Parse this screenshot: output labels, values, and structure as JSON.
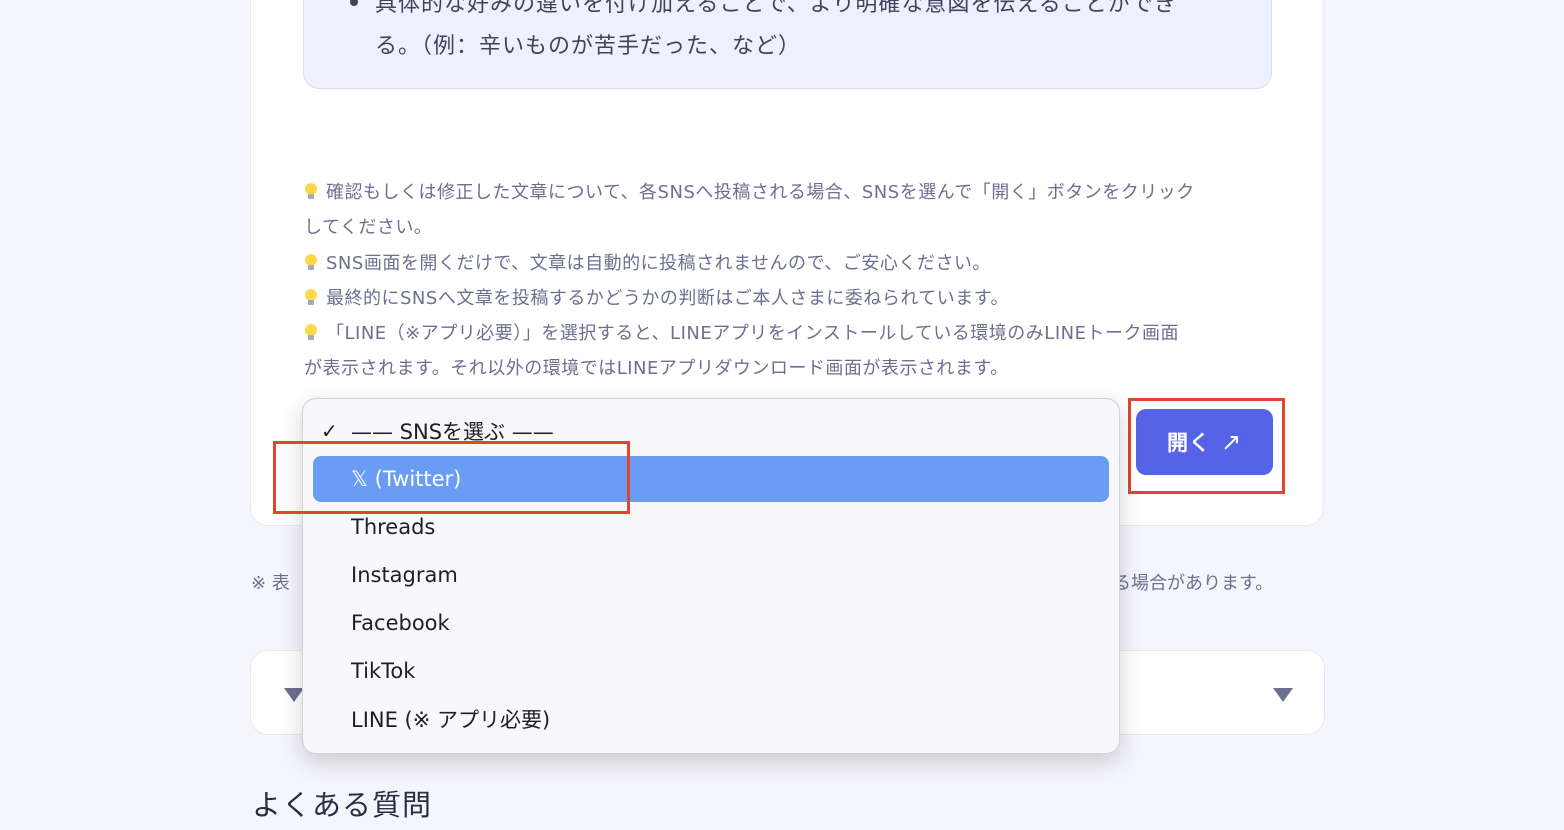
{
  "tip_box": {
    "line1": "具体的な好みの違いを付け加えることで、より明確な意図を伝えることができ",
    "line2": "る。（例：辛いものが苦手だった、など）"
  },
  "notes": {
    "n1a": "確認もしくは修正した文章について、各SNSへ投稿される場合、SNSを選んで「開く」ボタンをクリック",
    "n1b": "してください。",
    "n2": "SNS画面を開くだけで、文章は自動的に投稿されませんので、ご安心ください。",
    "n3": "最終的にSNSへ文章を投稿するかどうかの判断はご本人さまに委ねられています。",
    "n4a": "「LINE（※アプリ必要）」を選択すると、LINEアプリをインストールしている環境のみLINEトーク画面",
    "n4b": "が表示されます。それ以外の環境ではLINEアプリダウンロード画面が表示されます。"
  },
  "sns_select": {
    "options": [
      {
        "label": "—— SNSを選ぶ ——",
        "checked": true
      },
      {
        "label": "𝕏 (Twitter)",
        "highlighted": true
      },
      {
        "label": "Threads"
      },
      {
        "label": "Instagram"
      },
      {
        "label": "Facebook"
      },
      {
        "label": "TikTok"
      },
      {
        "label": "LINE (※ アプリ必要)"
      }
    ],
    "check_mark": "✓"
  },
  "open_button": {
    "label": "開く",
    "arrow": "↗"
  },
  "footnote": {
    "left": "※ 表",
    "right": "る場合があります。"
  },
  "faq": {
    "heading": "よくある質問"
  },
  "colors": {
    "accent": "#5563e8",
    "highlight_border": "#e0452d",
    "selected_option": "#6a9cf4"
  }
}
